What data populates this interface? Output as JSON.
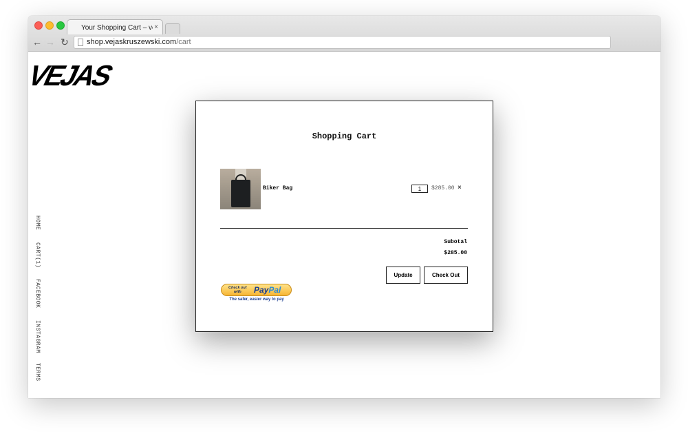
{
  "browser": {
    "tab_title": "Your Shopping Cart – vejas",
    "tab_close": "×",
    "url_host": "shop.vejaskruszewski.com",
    "url_path": "/cart"
  },
  "site": {
    "logo": "VEJAS",
    "nav": [
      "HOME",
      "CART(1)",
      "FACEBOOK",
      "INSTAGRAM",
      "TERMS"
    ]
  },
  "cart": {
    "title": "Shopping Cart",
    "item": {
      "name": "Biker Bag",
      "quantity": "1",
      "price": "$285.00",
      "remove_symbol": "×"
    },
    "subtotal_label": "Subotal",
    "subtotal_value": "$285.00",
    "update_label": "Update",
    "checkout_label": "Check Out",
    "paypal": {
      "line1": "Check out",
      "line2": "with",
      "logo_pay": "Pay",
      "logo_pal": "Pal",
      "tagline": "The safer, easier way to pay"
    }
  },
  "colors": {
    "paypal_gold": "#f7b534",
    "paypal_blue": "#1a3d8f"
  }
}
